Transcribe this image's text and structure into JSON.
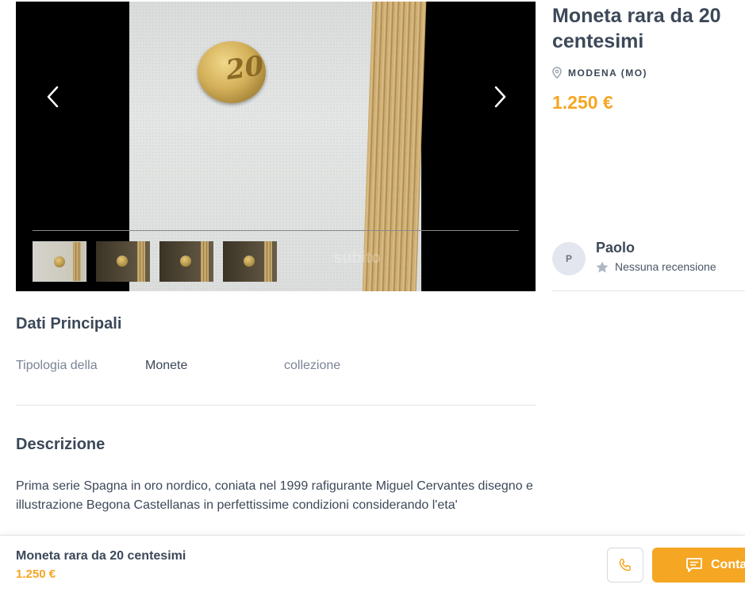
{
  "listing": {
    "title": "Moneta rara da 20 centesimi",
    "location": "MODENA (MO)",
    "price": "1.250 €"
  },
  "gallery": {
    "watermark": "subito",
    "thumbnail_count": 4,
    "active_index": 0,
    "icons": {
      "prev": "chevron-left-icon",
      "next": "chevron-right-icon"
    }
  },
  "seller": {
    "initial": "P",
    "name": "Paolo",
    "reviews": "Nessuna recensione"
  },
  "details": {
    "title": "Dati Principali",
    "row_label": "Tipologia della",
    "row_value": "Monete",
    "row_extra": "collezione"
  },
  "description": {
    "title": "Descrizione",
    "text": "Prima serie Spagna in oro nordico, coniata nel 1999 rafigurante Miguel Cervantes disegno e illustrazione Begona Castellanas in perfettissime condizioni considerando l'eta'"
  },
  "bottom_bar": {
    "title": "Moneta rara da 20 centesimi",
    "price": "1.250 €",
    "contact_label": "Conta"
  },
  "colors": {
    "accent": "#f5a623",
    "text": "#3c4858",
    "muted": "#7b8494"
  }
}
